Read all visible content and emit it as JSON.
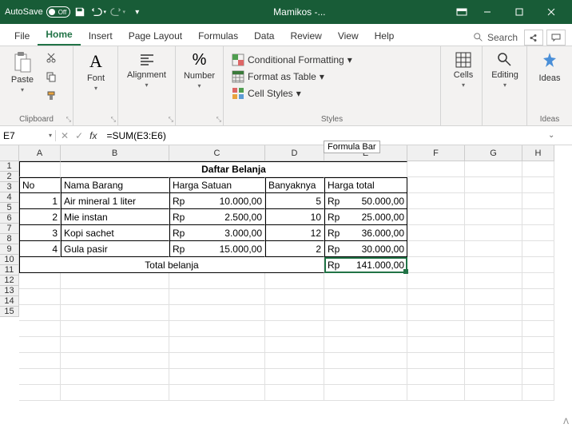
{
  "titlebar": {
    "autosave_label": "AutoSave",
    "autosave_state": "Off",
    "doc_name": "Mamikos -..."
  },
  "tabs": {
    "file": "File",
    "home": "Home",
    "insert": "Insert",
    "page_layout": "Page Layout",
    "formulas": "Formulas",
    "data": "Data",
    "review": "Review",
    "view": "View",
    "help": "Help",
    "search": "Search"
  },
  "ribbon": {
    "clipboard": {
      "label": "Clipboard",
      "paste": "Paste"
    },
    "font": {
      "label": "Font"
    },
    "alignment": {
      "label": "Alignment"
    },
    "number": {
      "label": "Number"
    },
    "styles": {
      "label": "Styles",
      "conditional": "Conditional Formatting",
      "format_table": "Format as Table",
      "cell_styles": "Cell Styles"
    },
    "cells": {
      "label": "Cells"
    },
    "editing": {
      "label": "Editing"
    },
    "ideas": {
      "label": "Ideas",
      "btn": "Ideas"
    }
  },
  "namebox": "E7",
  "formula": "=SUM(E3:E6)",
  "formula_bar_tooltip": "Formula Bar",
  "columns": [
    "A",
    "B",
    "C",
    "D",
    "E",
    "F",
    "G",
    "H"
  ],
  "sheet": {
    "title": "Daftar Belanja",
    "headers": {
      "no": "No",
      "nama": "Nama Barang",
      "harga_satuan": "Harga Satuan",
      "banyak": "Banyaknya",
      "harga_total": "Harga total"
    },
    "rows": [
      {
        "no": "1",
        "nama": "Air mineral 1 liter",
        "rp": "Rp",
        "harga": "10.000,00",
        "banyak": "5",
        "rp2": "Rp",
        "total": "50.000,00"
      },
      {
        "no": "2",
        "nama": "Mie instan",
        "rp": "Rp",
        "harga": "2.500,00",
        "banyak": "10",
        "rp2": "Rp",
        "total": "25.000,00"
      },
      {
        "no": "3",
        "nama": "Kopi sachet",
        "rp": "Rp",
        "harga": "3.000,00",
        "banyak": "12",
        "rp2": "Rp",
        "total": "36.000,00"
      },
      {
        "no": "4",
        "nama": "Gula pasir",
        "rp": "Rp",
        "harga": "15.000,00",
        "banyak": "2",
        "rp2": "Rp",
        "total": "30.000,00"
      }
    ],
    "footer_label": "Total belanja",
    "footer_rp": "Rp",
    "footer_total": "141.000,00"
  }
}
